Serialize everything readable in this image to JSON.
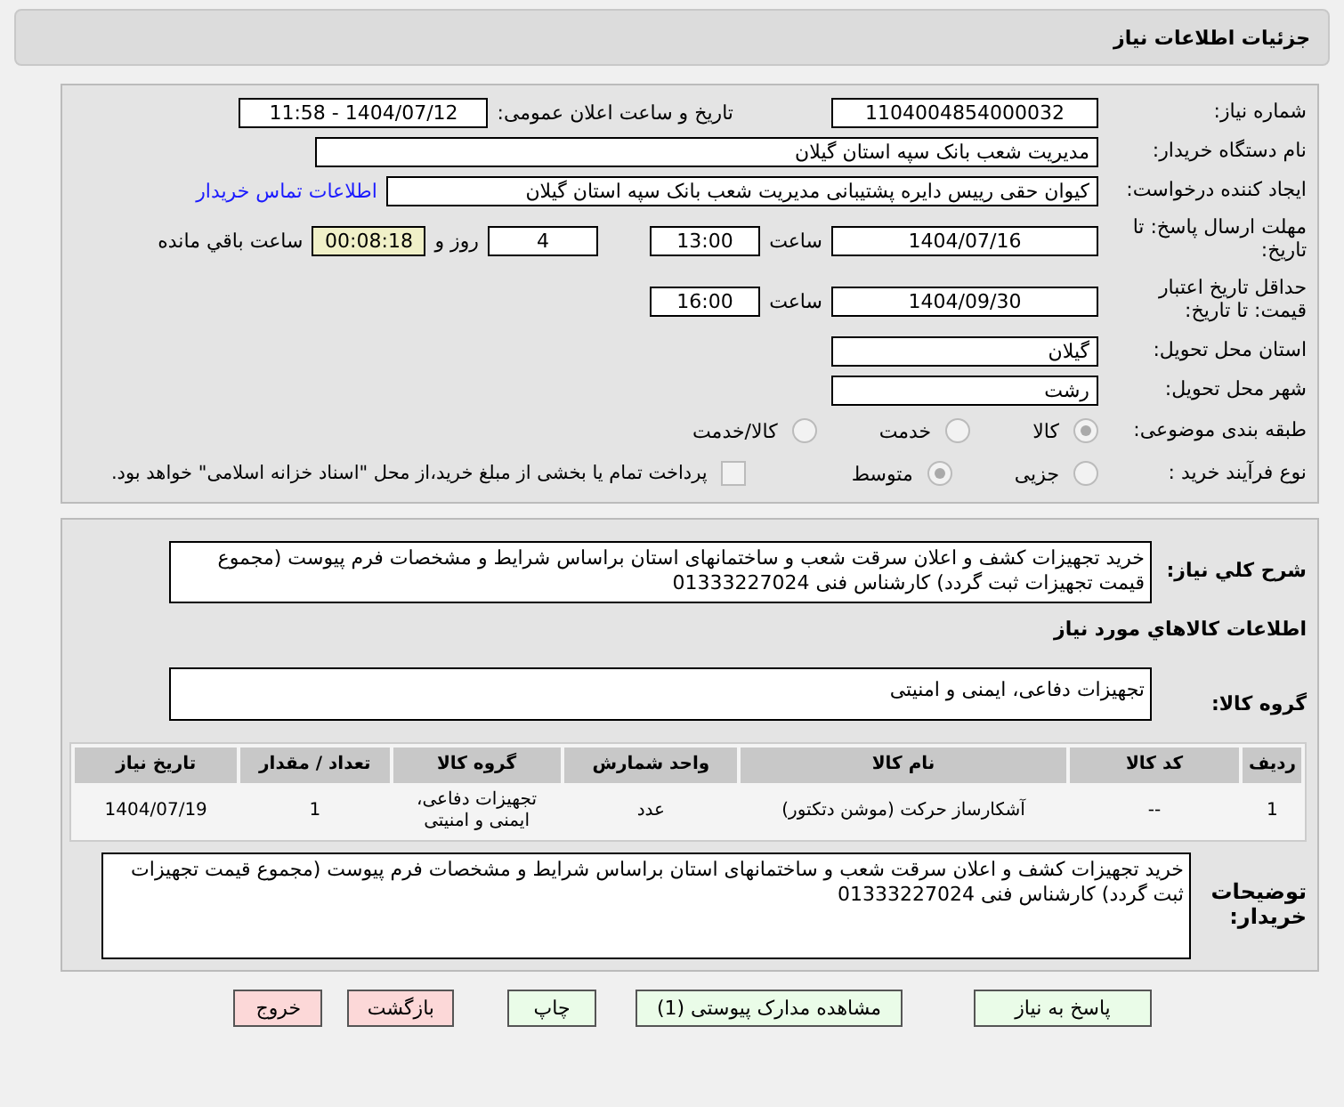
{
  "header": {
    "title": "جزئیات اطلاعات نیاز"
  },
  "need_number": {
    "label": "شماره نیاز:",
    "value": "1104004854000032"
  },
  "announce": {
    "label": "تاریخ و ساعت اعلان عمومی:",
    "value": "1404/07/12 - 11:58"
  },
  "buyer": {
    "label": "نام دستگاه خریدار:",
    "value": "مدیریت شعب بانک سپه استان گیلان"
  },
  "creator": {
    "label": "ایجاد کننده درخواست:",
    "value": "کیوان حقی رییس دایره پشتیبانی  مدیریت شعب بانک سپه استان گیلان",
    "link": "اطلاعات تماس خریدار"
  },
  "deadline": {
    "label": "مهلت ارسال پاسخ: تا تاریخ:",
    "date": "1404/07/16",
    "time_label": "ساعت",
    "time": "13:00",
    "days": "4",
    "days_label": "روز و",
    "remaining": "00:08:18",
    "remaining_label": "ساعت باقي مانده"
  },
  "validity": {
    "label": "حداقل تاریخ اعتبار قیمت: تا تاریخ:",
    "date": "1404/09/30",
    "time_label": "ساعت",
    "time": "16:00"
  },
  "province": {
    "label": "استان محل تحویل:",
    "value": "گیلان"
  },
  "city": {
    "label": "شهر محل تحویل:",
    "value": "رشت"
  },
  "category": {
    "label": "طبقه بندی موضوعی:",
    "options": [
      {
        "label": "کالا",
        "selected": true
      },
      {
        "label": "خدمت",
        "selected": false
      },
      {
        "label": "کالا/خدمت",
        "selected": false
      }
    ]
  },
  "purchase_type": {
    "label": "نوع فرآیند خرید :",
    "options": [
      {
        "label": "جزیی",
        "selected": false
      },
      {
        "label": "متوسط",
        "selected": true
      }
    ],
    "payment": {
      "label": "پرداخت تمام یا بخشی از مبلغ خرید،از محل \"اسناد خزانه اسلامی\" خواهد بود.",
      "checked": false
    }
  },
  "summary": {
    "label": "شرح کلي نیاز:",
    "value": "خرید تجهیزات کشف و اعلان سرقت شعب و ساختمانهای استان براساس شرایط و مشخصات فرم پیوست (مجموع قیمت تجهیزات ثبت گردد) کارشناس فنی 01333227024"
  },
  "goods_title": "اطلاعات کالاهاي مورد نياز",
  "goods_group": {
    "label": "گروه کالا:",
    "value": "تجهیزات دفاعی، ایمنی و امنیتی"
  },
  "table": {
    "columns": [
      "ردیف",
      "کد کالا",
      "نام کالا",
      "واحد شمارش",
      "گروه کالا",
      "تعداد / مقدار",
      "تاریخ نیاز"
    ],
    "rows": [
      [
        "1",
        "--",
        "آشکارساز حرکت (موشن دتکتور)",
        "عدد",
        "تجهیزات دفاعی، ایمنی و امنیتی",
        "1",
        "1404/07/19"
      ]
    ]
  },
  "buyer_notes": {
    "label": "توضیحات خریدار:",
    "value": "خرید تجهیزات کشف و اعلان سرقت شعب و ساختمانهای استان براساس شرایط و مشخصات فرم پیوست (مجموع قیمت تجهیزات ثبت گردد) کارشناس فنی 01333227024"
  },
  "buttons": [
    {
      "label": "پاسخ به نیاز",
      "kind": "primary"
    },
    {
      "label": "مشاهده مدارک پیوستی (1)",
      "kind": "primary"
    },
    {
      "label": "چاپ",
      "kind": "primary"
    },
    {
      "label": "بازگشت",
      "kind": "danger"
    },
    {
      "label": "خروج",
      "kind": "danger"
    }
  ]
}
